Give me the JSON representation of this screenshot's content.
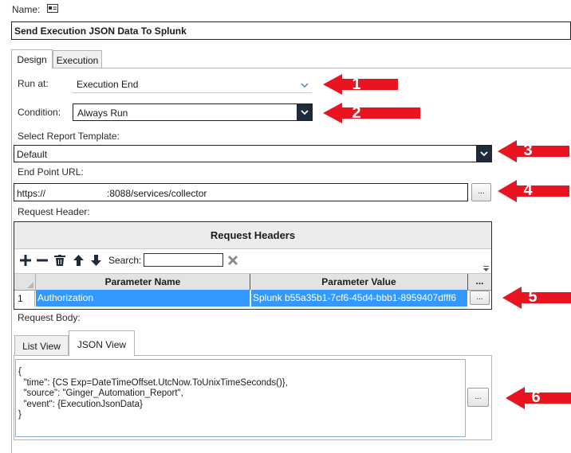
{
  "name": {
    "label": "Name:",
    "value": "Send Execution JSON Data To Splunk"
  },
  "tabs": [
    {
      "label": "Design"
    },
    {
      "label": "Execution"
    }
  ],
  "run_at": {
    "label": "Run at:",
    "value": "Execution End"
  },
  "condition": {
    "label": "Condition:",
    "value": "Always Run"
  },
  "report_template": {
    "label": "Select Report Template:",
    "value": "Default"
  },
  "endpoint": {
    "label": "End Point URL:",
    "value_prefix": "https://",
    "value_suffix": ":8088/services/collector",
    "browse_label": "..."
  },
  "request_header": {
    "label": "Request Header:",
    "grid_title": "Request Headers",
    "search_label": "Search:",
    "search_value": "",
    "columns": [
      "Parameter Name",
      "Parameter Value"
    ],
    "extra_col": "...",
    "rows": [
      {
        "index": "1",
        "name": "Authorization",
        "value": "Splunk b55a35b1-7cf6-45d4-bbb1-8959407dfff6",
        "btn": "..."
      }
    ]
  },
  "request_body": {
    "label": "Request Body:",
    "tabs": [
      {
        "label": "List View"
      },
      {
        "label": "JSON View"
      }
    ],
    "lines": [
      "{",
      "  \"time\": {CS Exp=DateTimeOffset.UtcNow.ToUnixTimeSeconds()},",
      "  \"source\": \"Ginger_Automation_Report\",",
      "  \"event\": {ExecutionJsonData}",
      "}"
    ],
    "browse_label": "..."
  },
  "annotations": [
    "1",
    "2",
    "3",
    "4",
    "5",
    "6"
  ],
  "colors": {
    "arrow": "#e8141f",
    "selection": "#3399ff",
    "dark_button": "#1f2b3a",
    "grid_header": "#eaeaea"
  }
}
